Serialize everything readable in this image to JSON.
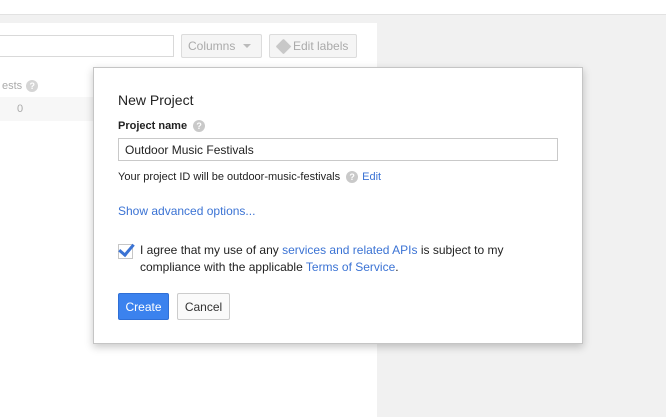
{
  "background": {
    "columns_label": "Columns",
    "edit_labels_label": "Edit labels",
    "column_header_partial": "ests",
    "column_help": "?",
    "row_value": "0"
  },
  "dialog": {
    "title": "New Project",
    "project_name_label": "Project name",
    "help_glyph": "?",
    "project_name_value": "Outdoor Music Festivals",
    "project_id_text": "Your project ID will be outdoor-music-festivals",
    "edit_link": "Edit",
    "advanced_link": "Show advanced options...",
    "agree_checked": true,
    "agree_prefix": "I agree that my use of any ",
    "agree_link_apis": "services and related APIs",
    "agree_middle": " is subject to my compliance with the applicable ",
    "agree_link_tos": "Terms of Service",
    "agree_suffix": ".",
    "create_button": "Create",
    "cancel_button": "Cancel"
  },
  "colors": {
    "link": "#3b73d4",
    "primary_button": "#3b82ee"
  }
}
